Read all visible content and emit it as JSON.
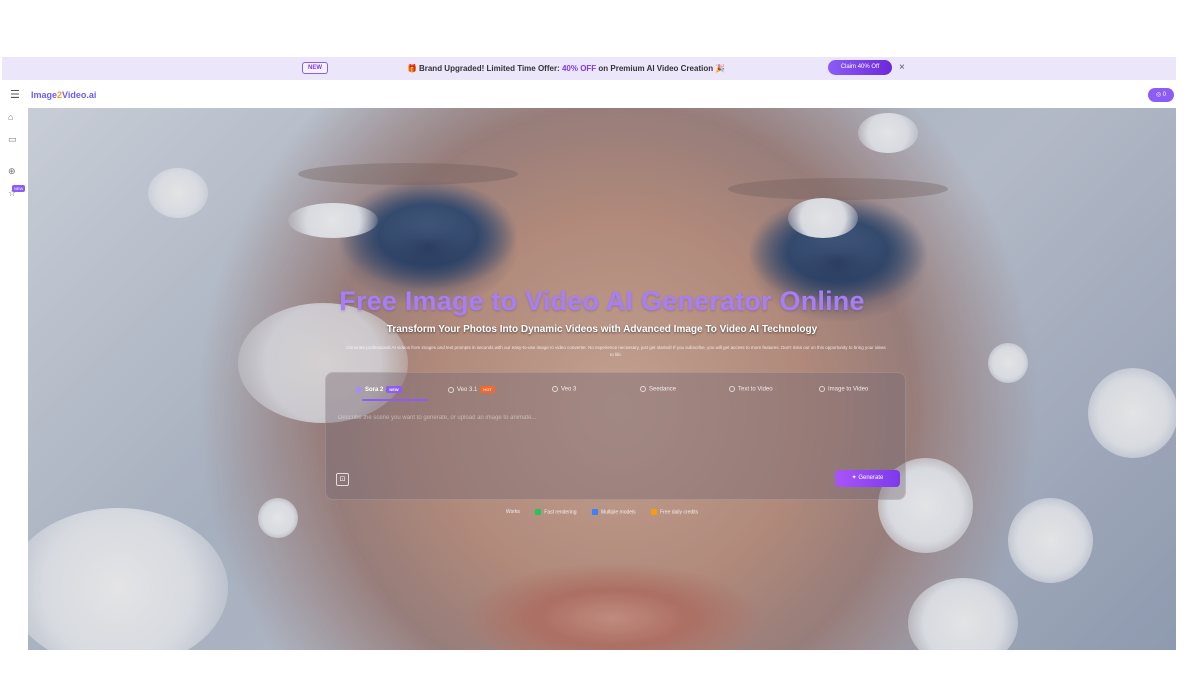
{
  "promo": {
    "new_tag": "NEW",
    "gift_icon": "gift-icon",
    "message_prefix": "Brand Upgraded! Limited Time Offer: ",
    "message_highlight": "40% OFF",
    "message_suffix": " on Premium AI Video Creation",
    "party_icon": "party-popper-icon",
    "claim_label": "Claim 40% Off",
    "close_icon": "×"
  },
  "header": {
    "menu_icon": "☰",
    "logo_part1": "Image",
    "logo_part2": "2",
    "logo_part3": "Video.ai",
    "credits": "◎ 0"
  },
  "sidebar": {
    "icons": [
      "⌂",
      "▭",
      "⊕",
      "☆"
    ],
    "new_badge": "NEW"
  },
  "hero": {
    "title": "Free Image to Video AI Generator Online",
    "subtitle": "Transform Your Photos Into Dynamic Videos with Advanced Image To Video AI Technology",
    "description": "Generate professional AI videos from images and text prompts in seconds with our easy-to-use image to video converter. No experience necessary, just get started! If you subscribe, you will get access to more features. Don't miss out on this opportunity to bring your ideas to life."
  },
  "generator": {
    "tabs": [
      {
        "label": "Sora 2",
        "badge": "NEW",
        "badge_color": "#8b5cf6",
        "active": true
      },
      {
        "label": "Veo 3.1",
        "badge": "HOT",
        "badge_color": "#ef6a2c",
        "active": false
      },
      {
        "label": "Veo 3",
        "badge": "",
        "active": false
      },
      {
        "label": "Seedance",
        "badge": "",
        "active": false
      },
      {
        "label": "Text to Video",
        "badge": "",
        "active": false
      },
      {
        "label": "Image to Video",
        "badge": "",
        "active": false
      }
    ],
    "prompt_placeholder": "Describe the scene you want to generate, or upload an image to animate...",
    "generate_label": "✦ Generate"
  },
  "features": [
    {
      "label": "Works",
      "color": ""
    },
    {
      "label": "Fast rendering",
      "color": "#22c55e"
    },
    {
      "label": "Multiple models",
      "color": "#3b82f6"
    },
    {
      "label": "Free daily credits",
      "color": "#f59e0b"
    }
  ]
}
